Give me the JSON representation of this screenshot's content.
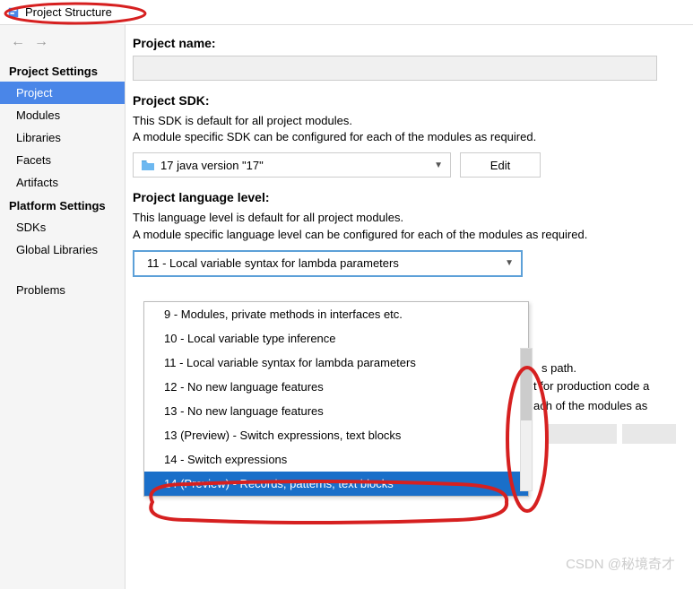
{
  "window": {
    "title": "Project Structure"
  },
  "sidebar": {
    "sections": [
      {
        "header": "Project Settings",
        "items": [
          "Project",
          "Modules",
          "Libraries",
          "Facets",
          "Artifacts"
        ],
        "selected": 0
      },
      {
        "header": "Platform Settings",
        "items": [
          "SDKs",
          "Global Libraries"
        ]
      },
      {
        "header": "",
        "items": [
          "Problems"
        ]
      }
    ]
  },
  "content": {
    "projectName": {
      "label": "Project name:",
      "value": ""
    },
    "projectSdk": {
      "label": "Project SDK:",
      "desc1": "This SDK is default for all project modules.",
      "desc2": "A module specific SDK can be configured for each of the modules as required.",
      "selected": "17 java version \"17\"",
      "editLabel": "Edit"
    },
    "langLevel": {
      "label": "Project language level:",
      "desc1": "This language level is default for all project modules.",
      "desc2": "A module specific language level can be configured for each of the modules as required.",
      "selected": "11 - Local variable syntax for lambda parameters",
      "options": [
        "9 - Modules, private methods in interfaces etc.",
        "10 - Local variable type inference",
        "11 - Local variable syntax for lambda parameters",
        "12 - No new language features",
        "13 - No new language features",
        "13 (Preview) - Switch expressions, text blocks",
        "14 - Switch expressions",
        "14 (Preview) - Records, patterns, text blocks"
      ],
      "highlighted": 7
    },
    "peek": {
      "p1": "s path.",
      "p2": "t for production code a",
      "p3": "ach of the modules as"
    }
  },
  "watermark": "CSDN @秘境奇才"
}
